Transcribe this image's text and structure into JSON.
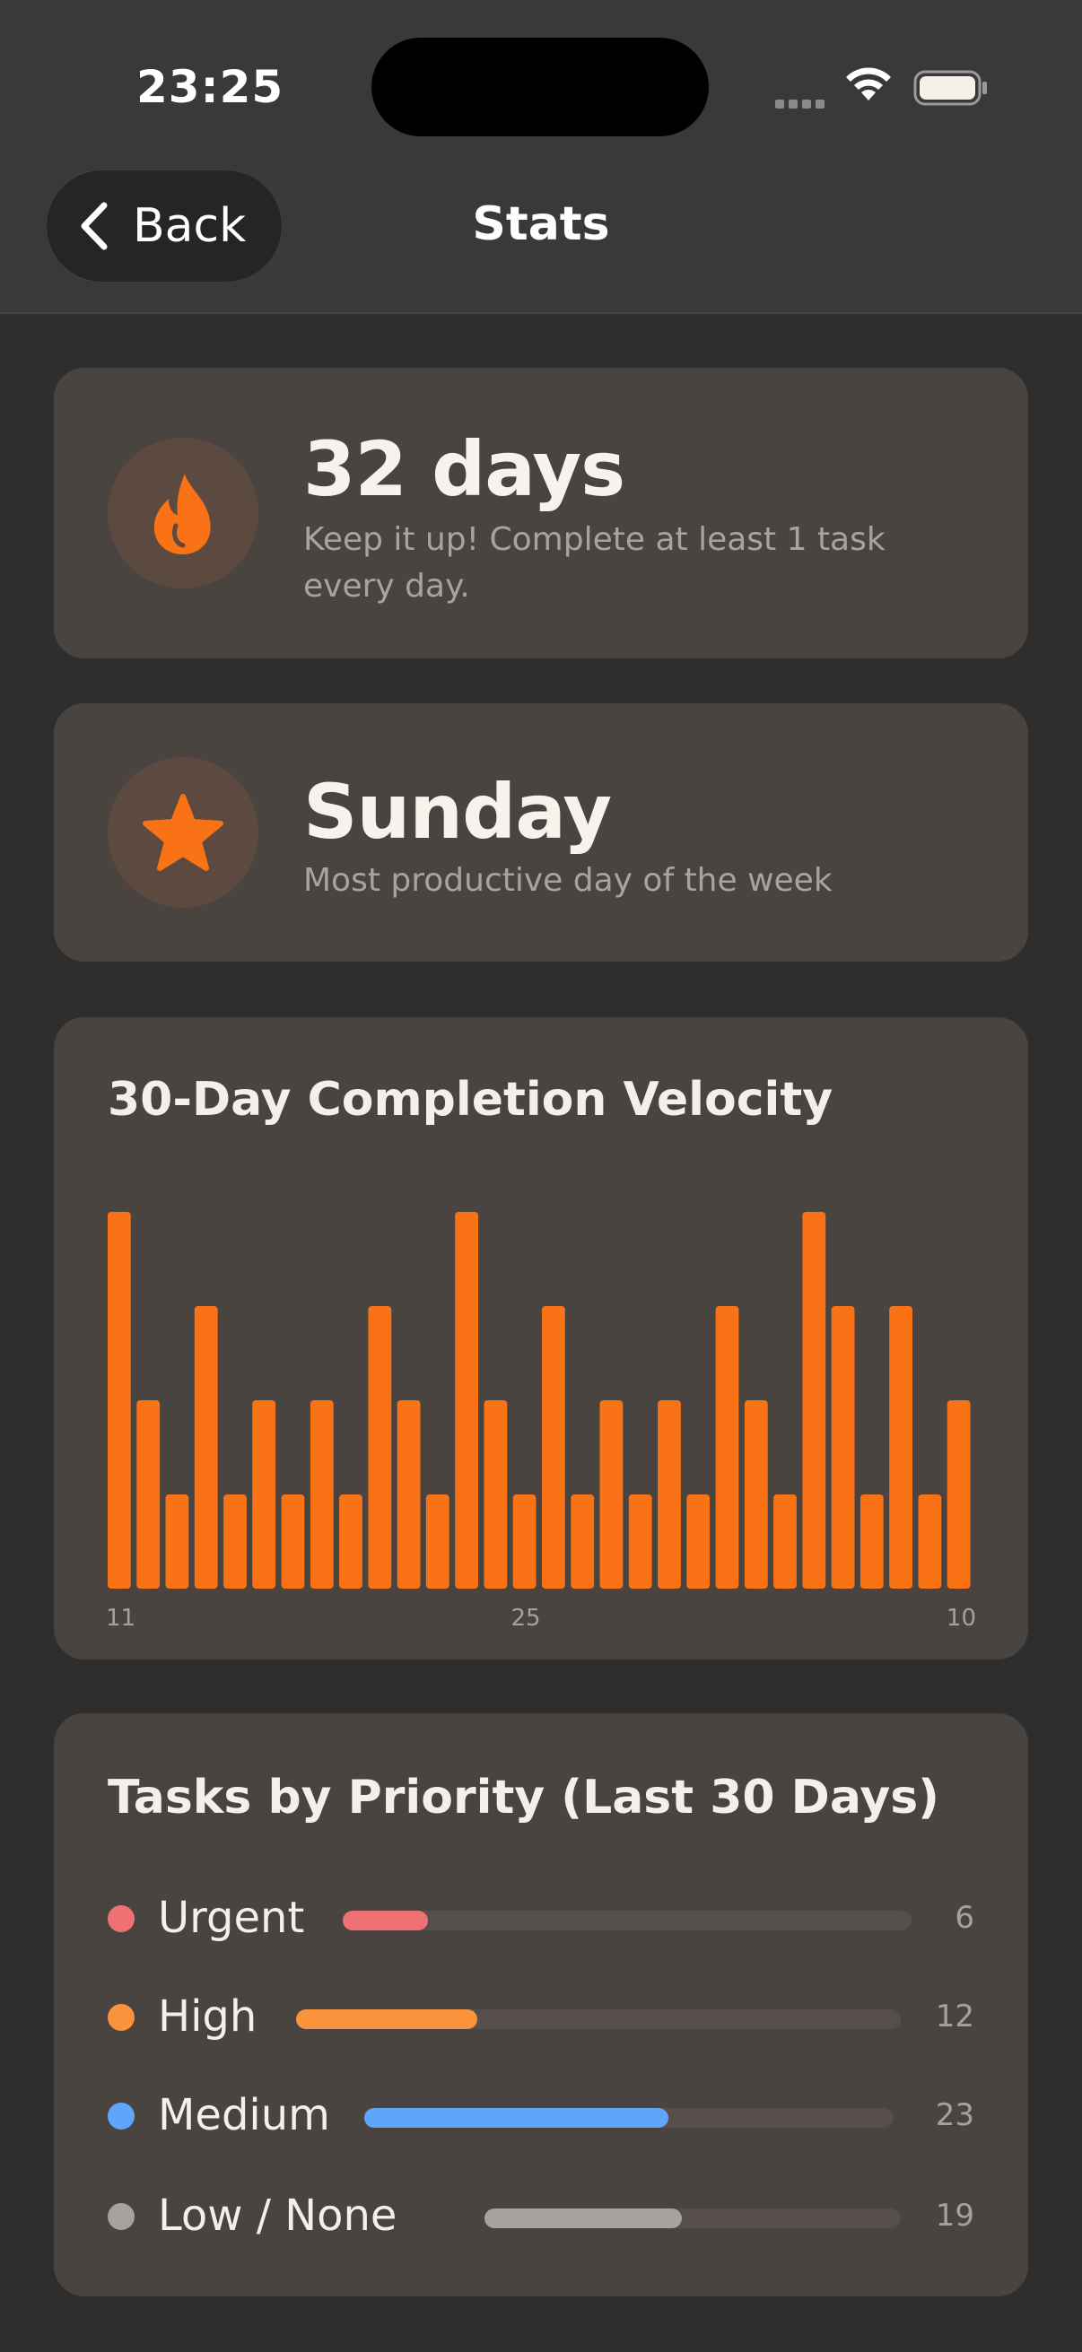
{
  "status_bar": {
    "time": "23:25"
  },
  "nav": {
    "back_label": "Back",
    "title": "Stats"
  },
  "streak": {
    "value": "32 days",
    "subtitle": "Keep it up! Complete at least 1 task every day.",
    "icon": "flame-icon"
  },
  "productive_day": {
    "value": "Sunday",
    "subtitle": "Most productive day of the week",
    "icon": "star-icon"
  },
  "velocity": {
    "title": "30-Day Completion Velocity",
    "x_labels": {
      "start": "11",
      "middle": "25",
      "end": "10"
    }
  },
  "chart_data": {
    "type": "bar",
    "title": "30-Day Completion Velocity",
    "values": [
      4,
      2,
      1,
      3,
      1,
      2,
      1,
      2,
      1,
      3,
      2,
      1,
      4,
      2,
      1,
      3,
      1,
      2,
      1,
      2,
      1,
      3,
      2,
      1,
      4,
      3,
      1,
      3,
      1,
      2
    ],
    "tick_labels": [
      "11",
      "25",
      "10"
    ],
    "ylim": [
      0,
      4
    ],
    "color": "#f97316"
  },
  "priority": {
    "title": "Tasks by Priority (Last 30 Days)",
    "items": [
      {
        "label": "Urgent",
        "count": "6",
        "value": 6,
        "color": "#f07173"
      },
      {
        "label": "High",
        "count": "12",
        "value": 12,
        "color": "#fb923c"
      },
      {
        "label": "Medium",
        "count": "23",
        "value": 23,
        "color": "#60a5fa"
      },
      {
        "label": "Low / None",
        "count": "19",
        "value": 19,
        "color": "#a8a29e"
      }
    ],
    "max": 40
  }
}
